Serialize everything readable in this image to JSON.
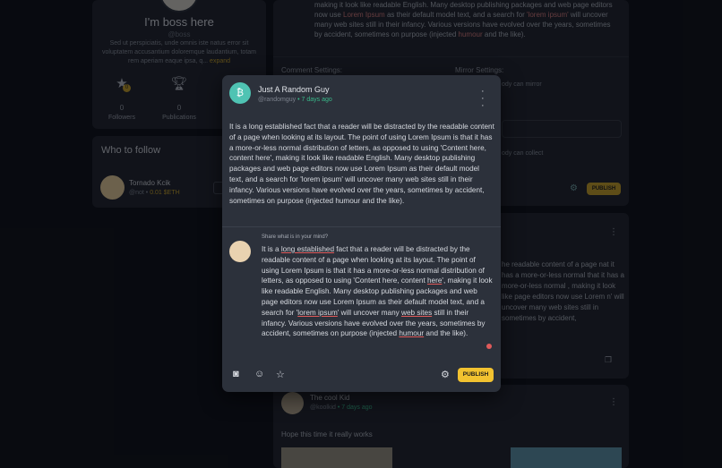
{
  "profile": {
    "name": "I'm boss here",
    "handle": "@boss",
    "bio": "Sed ut perspiciatis, unde omnis iste natus error sit voluptatem accusantium doloremque laudantium, totam rem aperiam eaque ipsa, q...",
    "expand_label": "expand",
    "badge_count": "0",
    "followers_count": "0",
    "followers_label": "Followers",
    "publications_count": "0",
    "publications_label": "Publications"
  },
  "who_to_follow": {
    "title": "Who to follow",
    "user": {
      "name": "Tornado Kcik",
      "handle": "@not",
      "eth": "0.01 $ETH"
    }
  },
  "feed": {
    "post1_text_a": "making it look like readable English. Many desktop publishing packages and web page editors now use ",
    "post1_hl1": "Lorem Ipsum",
    "post1_text_b": " as their default model text, and a search for ",
    "post1_hl2": "'lorem ipsum'",
    "post1_text_c": " will uncover many web sites still in their infancy. Various versions have evolved over the years, sometimes by accident, sometimes on purpose (injected ",
    "post1_hl3": "humour",
    "post1_text_d": " and the like).",
    "comment_settings": "Comment Settings:",
    "mirror_settings": "Mirror Settings:",
    "mirror_option": "ody can mirror",
    "collect_option": "ody can collect",
    "publish_label": "PUBLISH",
    "post2_text": "he readable content of a page nat it has a more-or-less normal that it has a more-or-less normal , making it look like page editors now use Lorem n' will uncover many web sites still in sometimes by accident,",
    "post3_name": "The cool Kid",
    "post3_handle": "@koolkid",
    "post3_ago": "7 days ago",
    "post3_text": "Hope this time it really works"
  },
  "modal": {
    "author_initial": "₿",
    "author_name": "Just A Random Guy",
    "author_handle": "@randomguy",
    "author_ago": "7 days ago",
    "post_text": "It is a long established fact that a reader will be distracted by the readable content of a page when looking at its layout. The point of using Lorem Ipsum is that it has a more-or-less normal distribution of letters, as opposed to using 'Content here, content here', making it look like readable English. Many desktop publishing packages and web page editors now use Lorem Ipsum as their default model text, and a search for 'lorem ipsum' will uncover many web sites still in their infancy. Various versions have evolved over the years, sometimes by accident, sometimes on purpose (injected humour and the like).",
    "comment_prompt": "Share what is in your mind?",
    "editor": {
      "t1": "It is a ",
      "s1": "long established",
      "t2": " fact that a reader will be distracted by the readable content of a page when looking at its layout. The point of using Lorem Ipsum is that it has a more-or-less normal distribution of letters, as opposed to using 'Content here, content ",
      "s2": "here",
      "t3": "', making it look like readable English. Many desktop publishing packages and web page editors now use Lorem Ipsum as their default model text, and a search for '",
      "s3": "lorem ipsum",
      "t4": "' will uncover many ",
      "s4": "web sites",
      "t5": " still in their infancy. Various versions have evolved over the years, sometimes by accident, sometimes on purpose (injected ",
      "s5": "humour",
      "t6": " and the like)."
    },
    "publish_label": "PUBLISH"
  }
}
